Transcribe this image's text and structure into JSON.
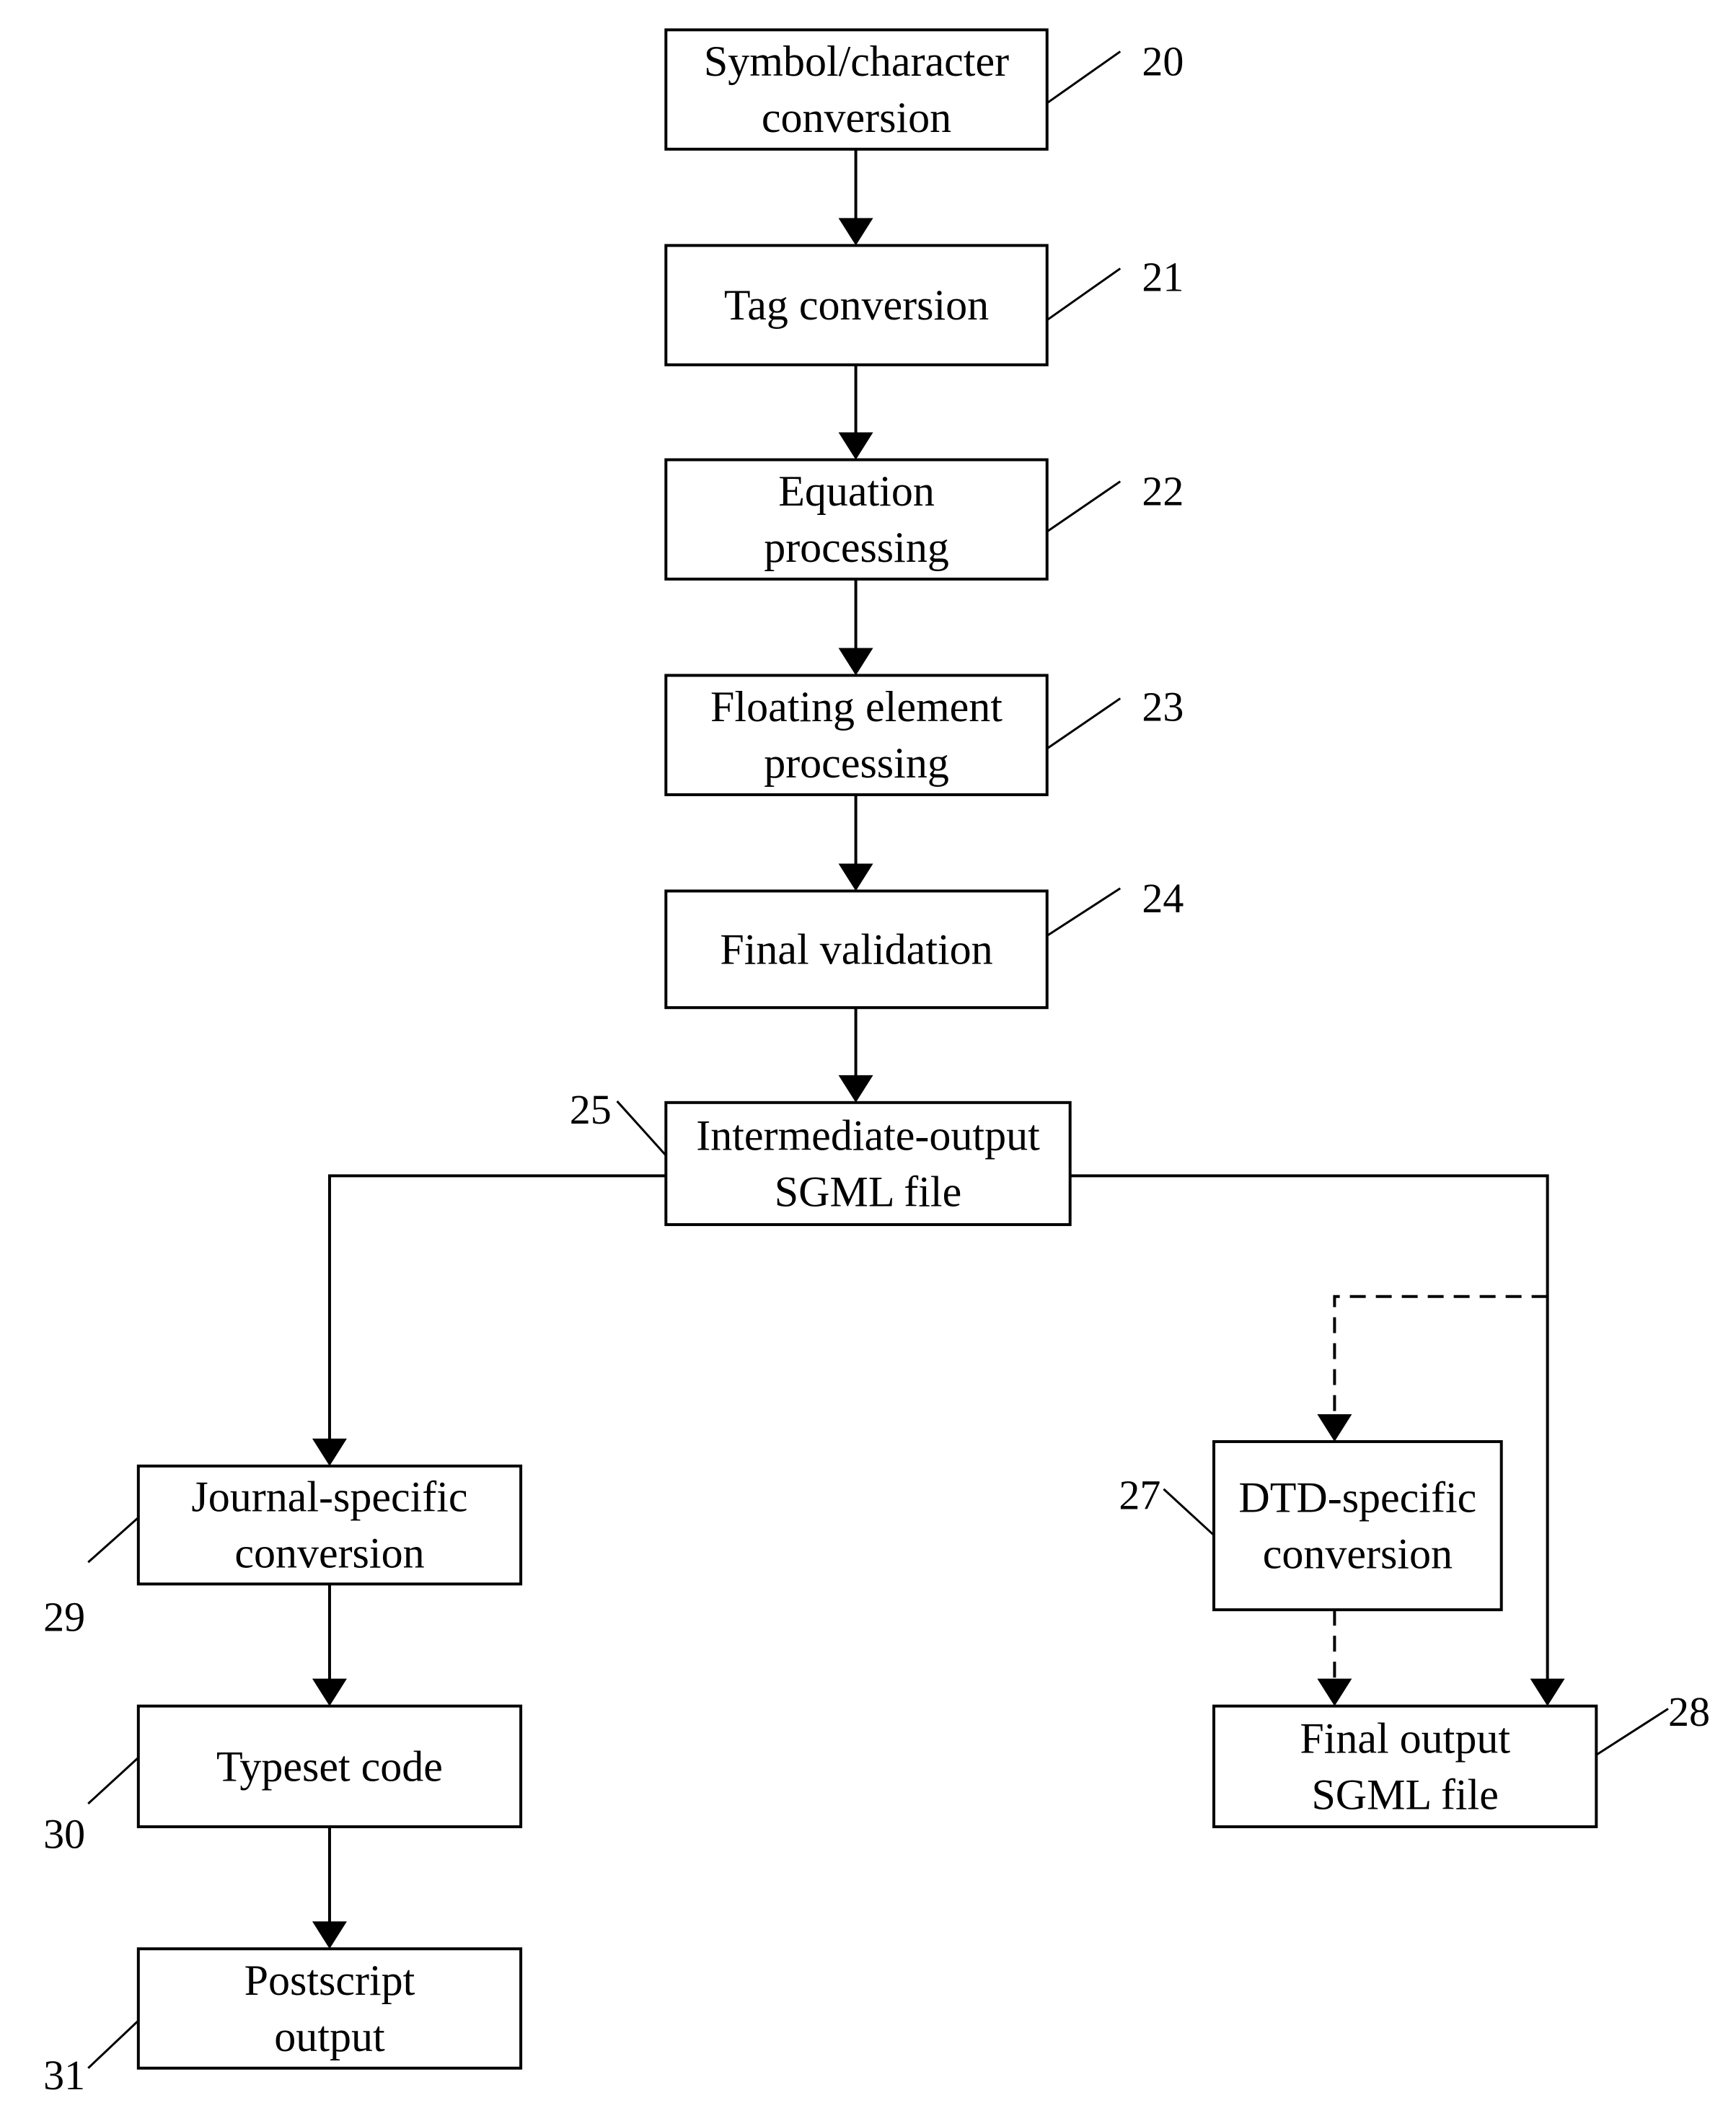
{
  "diagram": {
    "type": "flowchart",
    "colors": {
      "ink": "#000000",
      "paper": "#ffffff"
    },
    "nodes": [
      {
        "id": "20",
        "ref": "20",
        "lines": [
          "Symbol/character",
          "conversion"
        ]
      },
      {
        "id": "21",
        "ref": "21",
        "lines": [
          "Tag conversion"
        ]
      },
      {
        "id": "22",
        "ref": "22",
        "lines": [
          "Equation",
          "processing"
        ]
      },
      {
        "id": "23",
        "ref": "23",
        "lines": [
          "Floating element",
          "processing"
        ]
      },
      {
        "id": "24",
        "ref": "24",
        "lines": [
          "Final  validation"
        ]
      },
      {
        "id": "25",
        "ref": "25",
        "lines": [
          "Intermediate-output",
          "SGML file"
        ]
      },
      {
        "id": "27",
        "ref": "27",
        "lines": [
          "DTD-specific",
          "conversion"
        ]
      },
      {
        "id": "28",
        "ref": "28",
        "lines": [
          "Final output",
          "SGML file"
        ]
      },
      {
        "id": "29",
        "ref": "29",
        "lines": [
          "Journal-specific",
          "conversion"
        ]
      },
      {
        "id": "30",
        "ref": "30",
        "lines": [
          "Typeset code"
        ]
      },
      {
        "id": "31",
        "ref": "31",
        "lines": [
          "Postscript",
          "output"
        ]
      }
    ],
    "edges": [
      {
        "from": "20",
        "to": "21",
        "style": "solid"
      },
      {
        "from": "21",
        "to": "22",
        "style": "solid"
      },
      {
        "from": "22",
        "to": "23",
        "style": "solid"
      },
      {
        "from": "23",
        "to": "24",
        "style": "solid"
      },
      {
        "from": "24",
        "to": "25",
        "style": "solid"
      },
      {
        "from": "25",
        "to": "29",
        "style": "solid"
      },
      {
        "from": "25",
        "to": "28",
        "style": "solid"
      },
      {
        "from": "25",
        "to": "27",
        "style": "dashed"
      },
      {
        "from": "27",
        "to": "28",
        "style": "dashed"
      },
      {
        "from": "29",
        "to": "30",
        "style": "solid"
      },
      {
        "from": "30",
        "to": "31",
        "style": "solid"
      }
    ]
  }
}
